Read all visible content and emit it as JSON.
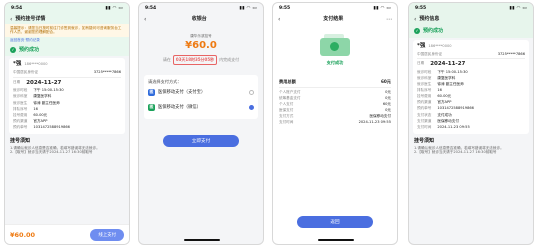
{
  "screens": {
    "s1": {
      "time": "9:54",
      "title": "预约挂号详情",
      "banner": "温馨提示：请您当日按时前往门诊签到就诊，如有疑问可咨询服务台工作人员，谢谢您的理解配合。",
      "link": "返回首页·预约记录",
      "status": "预约成功",
      "patient_name": "*强",
      "card_no": "186****0000",
      "id_label": "中国居民身份证",
      "id_value": "3725*****7866",
      "date": "2024-11-27",
      "fields": [
        {
          "k": "就诊时段",
          "v": "下午 15:00-15:30"
        },
        {
          "k": "就诊科室",
          "v": "康复医学科"
        },
        {
          "k": "就诊医生",
          "v": "徐涛 副主任医师"
        },
        {
          "k": "排队序号",
          "v": "16"
        },
        {
          "k": "挂号费用",
          "v": "60.00元"
        },
        {
          "k": "预约渠道",
          "v": "官方APP"
        },
        {
          "k": "预约单号",
          "v": "1031472588919866"
        }
      ],
      "notice_title": "挂号须知",
      "notice": "1.请确认就诊人信息是否准确，若填写错误将无法就诊。\n2.【取号】就诊当天请于2024-11-27 16:30前取号",
      "price": "¥60.00",
      "pay_btn": "线上支付"
    },
    "s2": {
      "time": "9:54",
      "title": "收银台",
      "merchant": "康华乐滨挂号",
      "amount": "¥60.0",
      "timer_prefix": "请在",
      "timer": "03天18时35分05秒",
      "timer_suffix": "内完成支付",
      "method_title": "请选择支付方式：",
      "methods": [
        {
          "name": "医保移动支付（支付宝）",
          "logo": "医"
        },
        {
          "name": "医保移动支付（微信）",
          "logo": "医"
        }
      ],
      "button": "立即支付"
    },
    "s3": {
      "time": "9:55",
      "title": "支付结果",
      "status_text": "支付成功",
      "total_label": "费用总额",
      "total_value": "60元",
      "rows": [
        {
          "k": "个人账户支付",
          "v": "0元"
        },
        {
          "k": "统筹基金支付",
          "v": "0元"
        },
        {
          "k": "个人支付",
          "v": "60元"
        },
        {
          "k": "医保支付",
          "v": "0元"
        },
        {
          "k": "支付方式",
          "v": "医保移动支付"
        },
        {
          "k": "支付时间",
          "v": "2024-11-23 09:55"
        }
      ],
      "button": "返回"
    },
    "s4": {
      "time": "9:55",
      "title": "预约信息",
      "status": "预约成功",
      "patient_name": "*强",
      "card_no": "186****0000",
      "id_label": "中国居民身份证",
      "id_value": "3725*****7866",
      "date": "2024-11-27",
      "fields": [
        {
          "k": "就诊时段",
          "v": "下午 15:00-15:30"
        },
        {
          "k": "就诊科室",
          "v": "康复医学科"
        },
        {
          "k": "就诊医生",
          "v": "徐涛 副主任医师"
        },
        {
          "k": "排队序号",
          "v": "16"
        },
        {
          "k": "挂号费用",
          "v": "60.00元"
        },
        {
          "k": "预约渠道",
          "v": "官方APP"
        },
        {
          "k": "预约单号",
          "v": "1031472588919866"
        },
        {
          "k": "支付状态",
          "v": "支付成功"
        },
        {
          "k": "支付渠道",
          "v": "医保移动支付"
        },
        {
          "k": "支付时间",
          "v": "2024-11-23 09:55"
        }
      ],
      "notice_title": "挂号须知",
      "notice": "1.请确认就诊人信息是否准确，若填写错误将无法就诊。\n2.【取号】就诊当天请于2024-11-27 16:30前取号"
    }
  },
  "colors": {
    "accent_blue": "#4a6ee0",
    "success_green": "#1aa15a",
    "price_orange": "#ee7a12"
  }
}
